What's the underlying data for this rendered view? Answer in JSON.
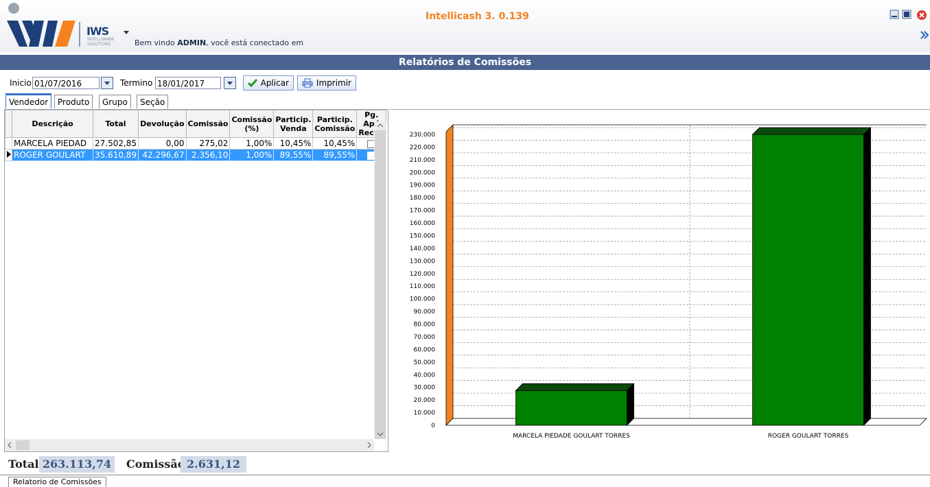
{
  "header": {
    "logo_text": "IWS",
    "logo_sub": "INTELLIWARE SOLUTIONS",
    "welcome_pre": "Bem vindo ",
    "welcome_user": "ADMIN",
    "welcome_post": ", você está conectado em",
    "app_title": "Intellicash 3. 0.139"
  },
  "window_title": "Relatórios de Comissões",
  "toolbar": {
    "inicio_label": "Inicio",
    "inicio_value": "01/07/2016",
    "termino_label": "Termino",
    "termino_value": "18/01/2017",
    "aplicar_label": "Aplicar",
    "imprimir_label": "Imprimir"
  },
  "tabs": [
    "Vendedor",
    "Produto",
    "Grupo",
    "Seção"
  ],
  "table": {
    "columns": [
      "Descrição",
      "Total",
      "Devolução",
      "Comissão",
      "Comissão (%)",
      "Particip. Venda",
      "Particip. Comissão",
      "Pg. Apó Receb"
    ],
    "rows": [
      [
        "MARCELA PIEDAD",
        "27.502,85",
        "0,00",
        "275,02",
        "1,00%",
        "10,45%",
        "10,45%",
        ""
      ],
      [
        "ROGER GOULART",
        "35.610,89",
        "42.296,67",
        "2.356,10",
        "1,00%",
        "89,55%",
        "89,55%",
        ""
      ]
    ]
  },
  "chart_data": {
    "type": "bar",
    "categories": [
      "MARCELA PIEDADE GOULART TORRES",
      "ROGER GOULART TORRES"
    ],
    "values": [
      27502.85,
      235610.89
    ],
    "ylim": [
      0,
      230000
    ],
    "ytick_step": 10000,
    "ytick_labels": [
      "0",
      "10.000",
      "20.000",
      "30.000",
      "40.000",
      "50.000",
      "60.000",
      "70.000",
      "80.000",
      "90.000",
      "100.000",
      "110.000",
      "120.000",
      "130.000",
      "140.000",
      "150.000",
      "160.000",
      "170.000",
      "180.000",
      "190.000",
      "200.000",
      "210.000",
      "220.000",
      "230.000"
    ],
    "grid": true,
    "bar_color": "#008000",
    "axis_accent": "#f5821f"
  },
  "totals": {
    "total_label": "Total",
    "total_value": "263.113,74",
    "comissao_label": "Comissão",
    "comissao_value": "2.631,12"
  },
  "bottom_tab": "Relatorio de Comissões"
}
